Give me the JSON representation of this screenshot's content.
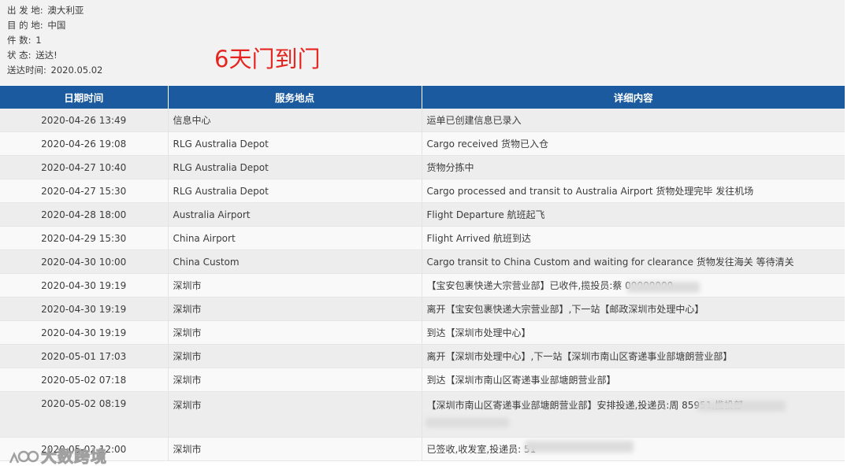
{
  "summary": {
    "origin": {
      "label": "出 发 地:",
      "value": "澳大利亚"
    },
    "destination": {
      "label": "目 的 地:",
      "value": "中国"
    },
    "pieces": {
      "label": "件 数:",
      "value": "1"
    },
    "status": {
      "label": "状 态:",
      "value": "送达!"
    },
    "delivered_time": {
      "label": "送达时间:",
      "value": "2020.05.02"
    }
  },
  "annotation": "6天门到门",
  "annotation_color": "#e5251f",
  "header_color": "#1b5a9e",
  "table": {
    "headers": {
      "time": "日期时间",
      "place": "服务地点",
      "detail": "详细内容"
    },
    "rows": [
      {
        "time": "2020-04-26 13:49",
        "place": "信息中心",
        "detail": "运单已创建信息已录入"
      },
      {
        "time": "2020-04-26 19:08",
        "place": "RLG Australia Depot",
        "detail": "Cargo received 货物已入仓"
      },
      {
        "time": "2020-04-27 10:40",
        "place": "RLG Australia Depot",
        "detail": "货物分拣中"
      },
      {
        "time": "2020-04-27 15:30",
        "place": "RLG Australia Depot",
        "detail": "Cargo processed and transit to Australia Airport 货物处理完毕 发往机场"
      },
      {
        "time": "2020-04-28 18:00",
        "place": "Australia Airport",
        "detail": "Flight Departure 航班起飞"
      },
      {
        "time": "2020-04-29 15:30",
        "place": "China Airport",
        "detail": "Flight Arrived 航班到达"
      },
      {
        "time": "2020-04-30 10:00",
        "place": "China Custom",
        "detail": "Cargo transit to China Custom and waiting for clearance 货物发往海关 等待清关"
      },
      {
        "time": "2020-04-30 19:19",
        "place": "深圳市",
        "detail": "【宝安包裹快递大宗营业部】已收件,揽投员:蔡                    00000000"
      },
      {
        "time": "2020-04-30 19:19",
        "place": "深圳市",
        "detail": "离开【宝安包裹快递大宗营业部】,下一站【邮政深圳市处理中心】"
      },
      {
        "time": "2020-04-30 19:19",
        "place": "深圳市",
        "detail": "到达【深圳市处理中心】"
      },
      {
        "time": "2020-05-01 17:03",
        "place": "深圳市",
        "detail": "离开【深圳市处理中心】,下一站【深圳市南山区寄递事业部塘朗营业部】"
      },
      {
        "time": "2020-05-02 07:18",
        "place": "深圳市",
        "detail": "到达【深圳市南山区寄递事业部塘朗营业部】"
      },
      {
        "time": "2020-05-02 08:19",
        "place": "深圳市",
        "detail": "【深圳市南山区寄递事业部塘朗营业部】安排投递,投递员:周                          85951,揽投部"
      },
      {
        "time": "2020-05-02 12:00",
        "place": "深圳市",
        "detail": "已签收,收发室,投递员:                          51"
      }
    ]
  },
  "watermark": {
    "icon": "logo-mark-icon",
    "text": "大数跨境"
  }
}
